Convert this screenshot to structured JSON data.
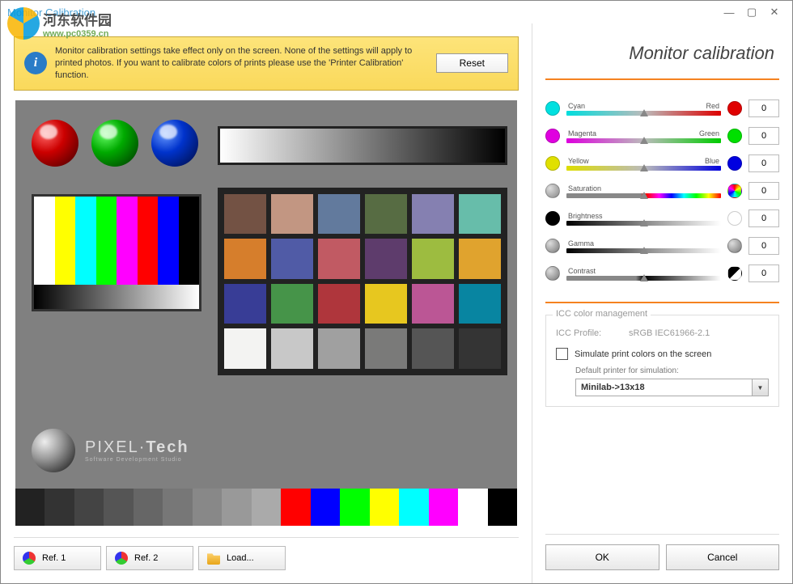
{
  "window": {
    "title": "Monitor Calibration"
  },
  "watermark": {
    "line1": "河东软件园",
    "line2": "www.pc0359.cn"
  },
  "info": {
    "text": "Monitor calibration settings take effect only on the screen. None of the settings will apply to printed photos. If you want to calibrate colors of prints please use the 'Printer Calibration' function.",
    "reset": "Reset"
  },
  "preview": {
    "logo_main": "PIXEL·Tech",
    "logo_sub": "Software Development Studio",
    "checker_colors": [
      "#735244",
      "#c29682",
      "#627a9d",
      "#576c43",
      "#8580b1",
      "#67bdaa",
      "#d67e2c",
      "#505ba6",
      "#c15a63",
      "#5e3c6c",
      "#9dbc40",
      "#e0a32e",
      "#383d96",
      "#469449",
      "#af363c",
      "#e7c71f",
      "#bb5695",
      "#0885a1",
      "#f3f3f2",
      "#c8c8c8",
      "#a0a0a0",
      "#7a7a79",
      "#555555",
      "#343434"
    ],
    "color_bars": [
      "#fff",
      "#ff0",
      "#0ff",
      "#0f0",
      "#f0f",
      "#f00",
      "#00f",
      "#000"
    ],
    "bottom_steps": [
      "#222",
      "#333",
      "#444",
      "#555",
      "#666",
      "#777",
      "#888",
      "#999",
      "#aaa",
      "#f00",
      "#00f",
      "#0f0",
      "#ff0",
      "#0ff",
      "#f0f",
      "#fff",
      "#000"
    ]
  },
  "ref": {
    "r1": "Ref. 1",
    "r2": "Ref. 2",
    "load": "Load..."
  },
  "right": {
    "title": "Monitor calibration"
  },
  "sliders": {
    "cyan": {
      "left": "Cyan",
      "right": "Red",
      "val": "0"
    },
    "magenta": {
      "left": "Magenta",
      "right": "Green",
      "val": "0"
    },
    "yellow": {
      "left": "Yellow",
      "right": "Blue",
      "val": "0"
    },
    "saturation": {
      "left": "Saturation",
      "right": "",
      "val": "0"
    },
    "brightness": {
      "left": "Brightness",
      "right": "",
      "val": "0"
    },
    "gamma": {
      "left": "Gamma",
      "right": "",
      "val": "0"
    },
    "contrast": {
      "left": "Contrast",
      "right": "",
      "val": "0"
    }
  },
  "icc": {
    "legend": "ICC color management",
    "profile_label": "ICC Profile:",
    "profile_value": "sRGB IEC61966-2.1",
    "simulate": "Simulate print colors on the screen",
    "default_printer_label": "Default printer for simulation:",
    "printer": "Minilab->13x18"
  },
  "buttons": {
    "ok": "OK",
    "cancel": "Cancel"
  }
}
